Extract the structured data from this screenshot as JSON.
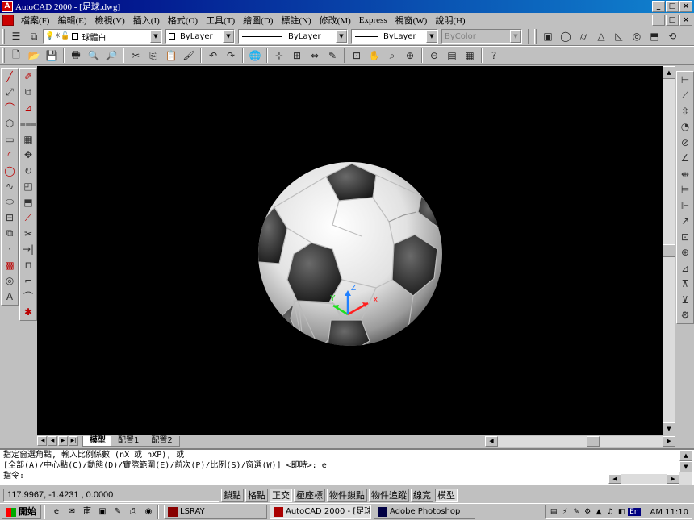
{
  "window": {
    "title": "AutoCAD 2000 - [足球.dwg]",
    "app_icon": "autocad-icon",
    "buttons": [
      "_",
      "□",
      "×"
    ],
    "doc_buttons": [
      "_",
      "□",
      "×"
    ]
  },
  "menu": {
    "items": [
      "檔案(F)",
      "編輯(E)",
      "檢視(V)",
      "插入(I)",
      "格式(O)",
      "工具(T)",
      "繪圖(D)",
      "標註(N)",
      "修改(M)",
      "Express",
      "視窗(W)",
      "說明(H)"
    ]
  },
  "layers_toolbar": {
    "layer_name": "球體白",
    "color": "ByLayer",
    "linetype": "ByLayer",
    "lineweight": "ByLayer",
    "plotstyle": "ByColor"
  },
  "standard_toolbar": {
    "icons": [
      "new-icon",
      "open-icon",
      "save-icon",
      "print-icon",
      "preview-icon",
      "find-icon",
      "cut-icon",
      "copy-icon",
      "paste-icon",
      "match-icon",
      "undo-icon",
      "redo-icon",
      "web-icon",
      "snap-icon",
      "ucs-icon",
      "distance-icon",
      "redraw-icon",
      "pan-icon",
      "zoom-realtime-icon",
      "zoom-window-icon",
      "zoom-previous-icon",
      "properties-icon",
      "design-center-icon",
      "db-icon",
      "help-icon"
    ],
    "glyphs": [
      "🗋",
      "📂",
      "💾",
      "🖶",
      "🔍",
      "🔎",
      "✂",
      "⎘",
      "📋",
      "🖌",
      "↶",
      "↷",
      "🌐",
      "⊹",
      "⊞",
      "⇔",
      "✎",
      "⊡",
      "✋",
      "⌕",
      "⊕",
      "⊖",
      "▤",
      "▦",
      "?"
    ]
  },
  "draw_toolbar": {
    "icons": [
      "line-icon",
      "xline-icon",
      "pline-icon",
      "polygon-icon",
      "rectangle-icon",
      "arc-icon",
      "circle-icon",
      "spline-icon",
      "ellipse-icon",
      "insert-icon",
      "block-icon",
      "point-icon",
      "hatch-icon",
      "region-icon",
      "text-icon"
    ],
    "glyphs": [
      "╱",
      "⤢",
      "⌒",
      "⬡",
      "▭",
      "◜",
      "◯",
      "∿",
      "⬭",
      "⊟",
      "⧉",
      "·",
      "▩",
      "◎",
      "A"
    ]
  },
  "modify_toolbar": {
    "icons": [
      "erase-icon",
      "copy-object-icon",
      "mirror-icon",
      "offset-icon",
      "array-icon",
      "move-icon",
      "rotate-icon",
      "scale-icon",
      "stretch-icon",
      "lengthen-icon",
      "trim-icon",
      "extend-icon",
      "break-icon",
      "chamfer-icon",
      "fillet-icon",
      "explode-icon"
    ],
    "glyphs": [
      "✐",
      "⧉",
      "⊿",
      "⩶",
      "▦",
      "✥",
      "↻",
      "◰",
      "⬒",
      "⟋",
      "✂",
      "→|",
      "⊓",
      "⌐",
      "⌒",
      "✱"
    ]
  },
  "dim_toolbar": {
    "icons": [
      "dim-linear-icon",
      "dim-aligned-icon",
      "dim-ordinate-icon",
      "dim-radius-icon",
      "dim-diameter-icon",
      "dim-angular-icon",
      "quick-dim-icon",
      "dim-baseline-icon",
      "dim-continue-icon",
      "leader-icon",
      "tolerance-icon",
      "center-mark-icon",
      "dim-edit-icon",
      "dim-text-edit-icon",
      "dim-update-icon",
      "dim-style-icon"
    ],
    "glyphs": [
      "⊢",
      "⟋",
      "⇳",
      "◔",
      "⊘",
      "∠",
      "⇹",
      "⊨",
      "⊩",
      "↗",
      "⊡",
      "⊕",
      "⊿",
      "⊼",
      "⊻",
      "⚙"
    ]
  },
  "viewport": {
    "background": "#000000",
    "ucs": {
      "x": "X",
      "y": "Y",
      "z": "Z"
    },
    "ucs_colors": {
      "x": "#ff2020",
      "y": "#20e020",
      "z": "#2080ff"
    }
  },
  "layout_tabs": {
    "nav": [
      "|◀",
      "◀",
      "▶",
      "▶|"
    ],
    "tabs": [
      "模型",
      "配置1",
      "配置2"
    ],
    "active": 0
  },
  "command": {
    "lines": [
      "指定窗選角點, 輸入比例係數 (nX 或 nXP), 或",
      "[全部(A)/中心點(C)/動態(D)/實際範圍(E)/前次(P)/比例(S)/窗選(W)] <即時>: e",
      "指令:"
    ]
  },
  "status": {
    "coords": "117.9967, -1.4231 , 0.0000",
    "toggles": [
      {
        "label": "鎖點",
        "on": false
      },
      {
        "label": "格點",
        "on": false
      },
      {
        "label": "正交",
        "on": true
      },
      {
        "label": "極座標",
        "on": false
      },
      {
        "label": "物件鎖點",
        "on": false
      },
      {
        "label": "物件追蹤",
        "on": false
      },
      {
        "label": "線寬",
        "on": false
      },
      {
        "label": "模型",
        "on": true
      }
    ]
  },
  "taskbar": {
    "start": "開始",
    "quicklaunch": [
      "ie-icon",
      "outlook-icon",
      "nan-icon",
      "app-icon",
      "notepad-icon",
      "edit-icon",
      "browser-icon"
    ],
    "quicklaunch_glyphs": [
      "e",
      "✉",
      "南",
      "▣",
      "✎",
      "⎙",
      "◉"
    ],
    "tasks": [
      {
        "label": "LSRAY",
        "active": false
      },
      {
        "label": "AutoCAD 2000 - [足球...",
        "active": true
      },
      {
        "label": "Adobe Photoshop",
        "active": false
      }
    ],
    "tray_glyphs": [
      "▤",
      "⚡",
      "✎",
      "⚙",
      "▲",
      "♫",
      "◧"
    ],
    "lang": "En",
    "clock": "AM 11:10"
  }
}
